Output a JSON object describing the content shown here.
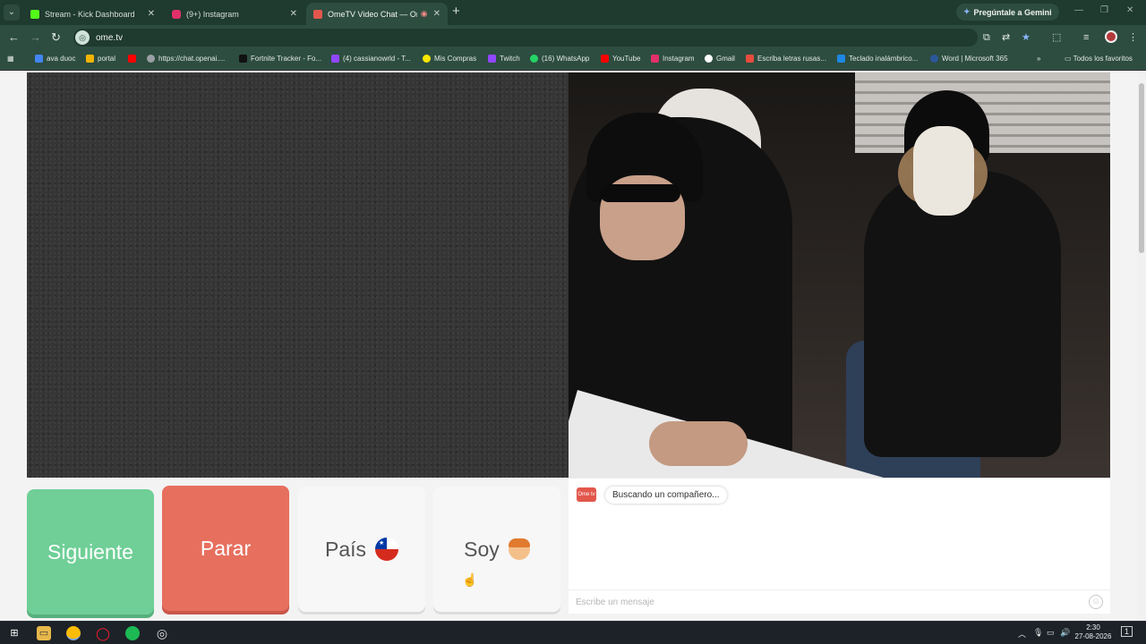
{
  "browser": {
    "tabs": [
      {
        "label": "Stream - Kick Dashboard",
        "favicon": "kick-icon",
        "color": "#53fc18",
        "active": false
      },
      {
        "label": "(9+) Instagram",
        "favicon": "instagram-icon",
        "color": "#e1306c",
        "active": false
      },
      {
        "label": "OmeTV Video Chat — Ome",
        "favicon": "ometv-icon",
        "color": "#e2574c",
        "active": true
      }
    ],
    "gemini_label": "Pregúntale a Gemini",
    "url": "ome.tv",
    "bookmarks": [
      {
        "label": "ava duoc",
        "color": "#4285f4"
      },
      {
        "label": "portal",
        "color": "#f4b400"
      },
      {
        "label": "",
        "color": "#ff0000"
      },
      {
        "label": "https://chat.openai....",
        "color": "#9aa0a6"
      },
      {
        "label": "Fortnite Tracker - Fo...",
        "color": "#111111"
      },
      {
        "label": "(4) cassianowrld - T...",
        "color": "#9146ff"
      },
      {
        "label": "Mis Compras",
        "color": "#ffe600"
      },
      {
        "label": "Twitch",
        "color": "#9146ff"
      },
      {
        "label": "(16) WhatsApp",
        "color": "#25d366"
      },
      {
        "label": "YouTube",
        "color": "#ff0000"
      },
      {
        "label": "Instagram",
        "color": "#e1306c"
      },
      {
        "label": "Gmail",
        "color": "#ffffff"
      },
      {
        "label": "Escriba letras rusas...",
        "color": "#e74c3c"
      },
      {
        "label": "Teclado inalámbrico...",
        "color": "#1e88e5"
      },
      {
        "label": "Word | Microsoft 365",
        "color": "#2b579a"
      }
    ],
    "all_bookmarks": "Todos los favoritos"
  },
  "controls": {
    "next": "Siguiente",
    "stop": "Parar",
    "country": "País",
    "gender": "Soy"
  },
  "chat": {
    "logo": "Ome tv",
    "status": "Buscando un compañero...",
    "placeholder": "Escribe un mensaje"
  },
  "taskbar": {
    "time": "2:30",
    "date": "27-08-2026",
    "notifications": "1"
  },
  "colors": {
    "next": "#6fcf97",
    "stop": "#e76f5e",
    "chrome": "#2d4d40"
  }
}
